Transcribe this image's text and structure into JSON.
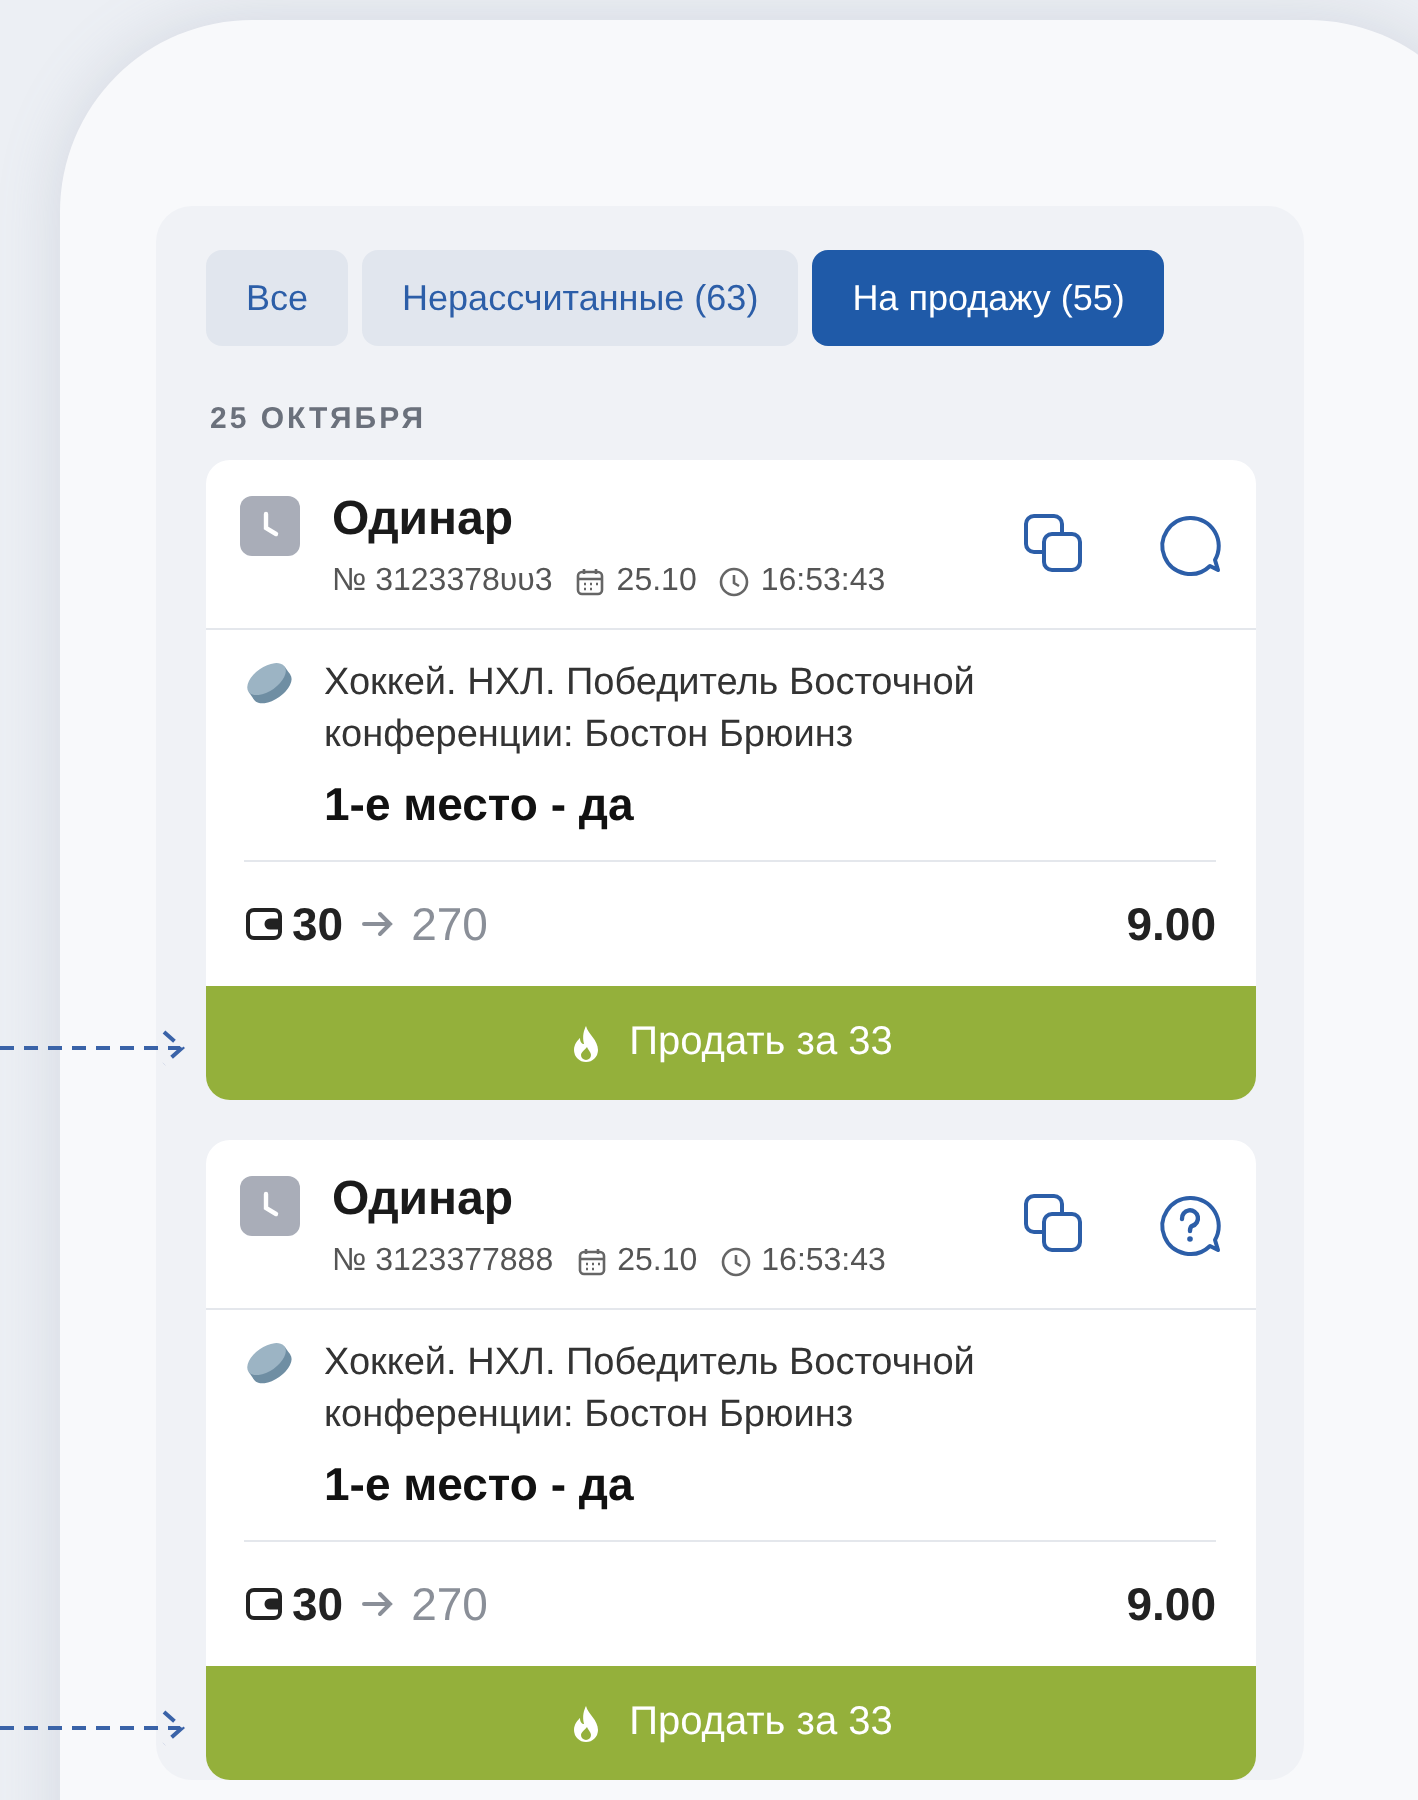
{
  "tabs": [
    {
      "label": "Все",
      "selected": false
    },
    {
      "label": "Нерассчитанные (63)",
      "selected": false
    },
    {
      "label": "На продажу (55)",
      "selected": true
    }
  ],
  "date_heading": "25 ОКТЯБРЯ",
  "bets": [
    {
      "type": "Одинар",
      "number": "№ 3123378υυ3",
      "date": "25.10",
      "time": "16:53:43",
      "question_mark": false,
      "event": "Хоккей. НХЛ. Победитель Восточной конференции: Бостон Брюинз",
      "outcome": "1-е место - да",
      "stake": "30",
      "payout": "270",
      "odds": "9.00",
      "sell_label": "Продать за 33"
    },
    {
      "type": "Одинар",
      "number": "№ 3123377888",
      "date": "25.10",
      "time": "16:53:43",
      "question_mark": true,
      "event": "Хоккей. НХЛ. Победитель Восточной конференции: Бостон Брюинз",
      "outcome": "1-е место - да",
      "stake": "30",
      "payout": "270",
      "odds": "9.00",
      "sell_label": "Продать за 33"
    }
  ]
}
